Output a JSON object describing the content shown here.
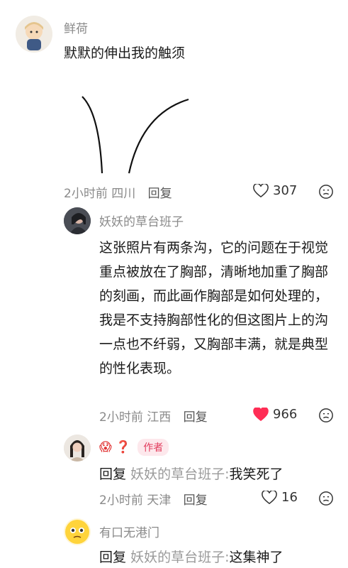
{
  "comments": [
    {
      "username": "鲜荷",
      "text": "默默的伸出我的触须",
      "time": "2小时前",
      "location": "四川",
      "reply_label": "回复",
      "likes": "307",
      "liked": false
    },
    {
      "username": "妖妖的草台班子",
      "text": "这张照片有两条沟，它的问题在于视觉重点被放在了胸部，清晰地加重了胸部的刻画，而此画作胸部是如何处理的，我是不支持胸部性化的但这图片上的沟一点也不纤弱，又胸部丰满，就是典型的性化表现。",
      "time": "2小时前",
      "location": "江西",
      "reply_label": "回复",
      "likes": "966",
      "liked": true
    },
    {
      "username": "😱 ❓",
      "badge": "作者",
      "reply_prefix": "回复",
      "reply_target": "妖妖的草台班子:",
      "text": "我笑死了",
      "time": "2小时前",
      "location": "天津",
      "reply_label": "回复",
      "likes": "16",
      "liked": false
    },
    {
      "username": "有口无港门",
      "reply_prefix": "回复",
      "reply_target": "妖妖的草台班子:",
      "text": "这集神了"
    }
  ],
  "colors": {
    "liked": "#ff2d55",
    "badge_bg": "#fde8ec",
    "badge_text": "#e23d5e"
  }
}
